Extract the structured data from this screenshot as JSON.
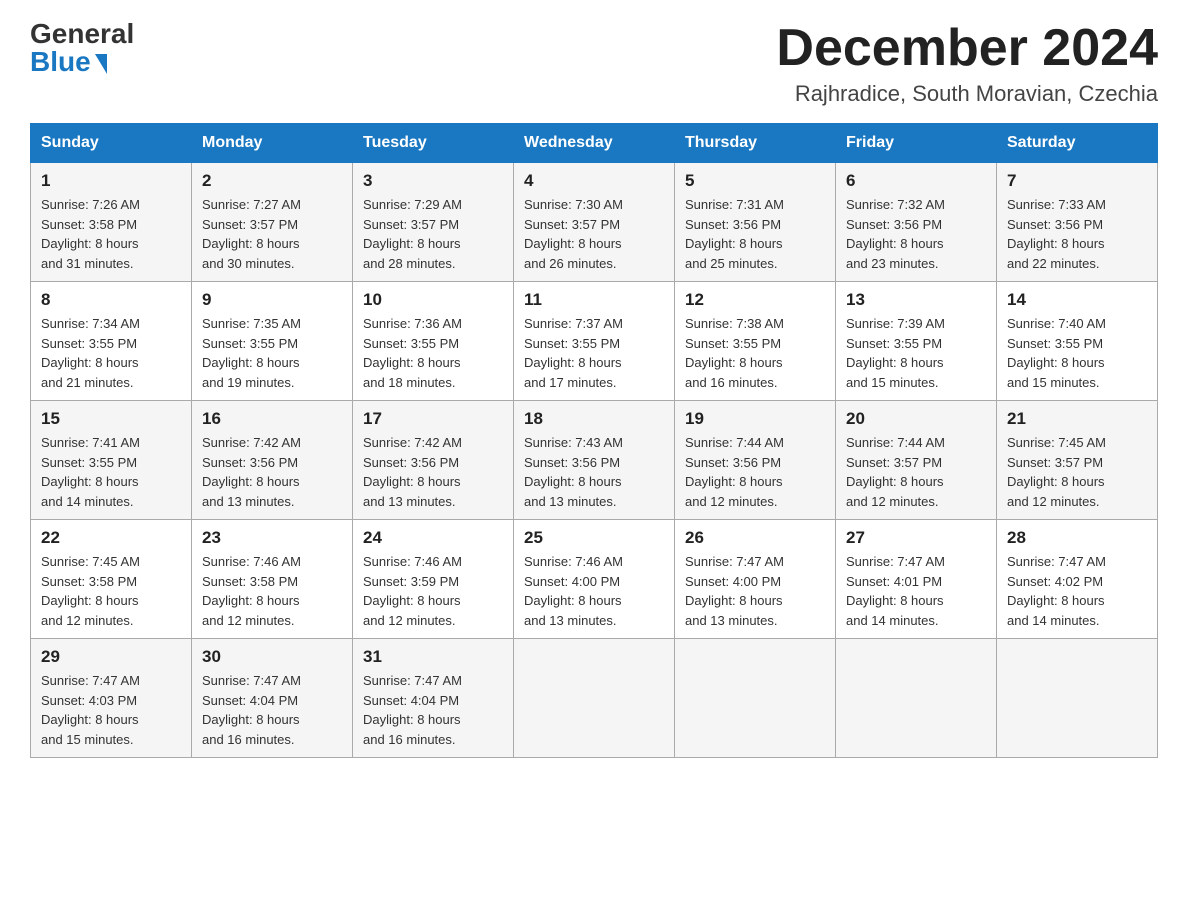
{
  "logo": {
    "general": "General",
    "blue": "Blue"
  },
  "title": "December 2024",
  "location": "Rajhradice, South Moravian, Czechia",
  "days_of_week": [
    "Sunday",
    "Monday",
    "Tuesday",
    "Wednesday",
    "Thursday",
    "Friday",
    "Saturday"
  ],
  "weeks": [
    [
      {
        "day": "1",
        "sunrise": "7:26 AM",
        "sunset": "3:58 PM",
        "daylight": "8 hours and 31 minutes."
      },
      {
        "day": "2",
        "sunrise": "7:27 AM",
        "sunset": "3:57 PM",
        "daylight": "8 hours and 30 minutes."
      },
      {
        "day": "3",
        "sunrise": "7:29 AM",
        "sunset": "3:57 PM",
        "daylight": "8 hours and 28 minutes."
      },
      {
        "day": "4",
        "sunrise": "7:30 AM",
        "sunset": "3:57 PM",
        "daylight": "8 hours and 26 minutes."
      },
      {
        "day": "5",
        "sunrise": "7:31 AM",
        "sunset": "3:56 PM",
        "daylight": "8 hours and 25 minutes."
      },
      {
        "day": "6",
        "sunrise": "7:32 AM",
        "sunset": "3:56 PM",
        "daylight": "8 hours and 23 minutes."
      },
      {
        "day": "7",
        "sunrise": "7:33 AM",
        "sunset": "3:56 PM",
        "daylight": "8 hours and 22 minutes."
      }
    ],
    [
      {
        "day": "8",
        "sunrise": "7:34 AM",
        "sunset": "3:55 PM",
        "daylight": "8 hours and 21 minutes."
      },
      {
        "day": "9",
        "sunrise": "7:35 AM",
        "sunset": "3:55 PM",
        "daylight": "8 hours and 19 minutes."
      },
      {
        "day": "10",
        "sunrise": "7:36 AM",
        "sunset": "3:55 PM",
        "daylight": "8 hours and 18 minutes."
      },
      {
        "day": "11",
        "sunrise": "7:37 AM",
        "sunset": "3:55 PM",
        "daylight": "8 hours and 17 minutes."
      },
      {
        "day": "12",
        "sunrise": "7:38 AM",
        "sunset": "3:55 PM",
        "daylight": "8 hours and 16 minutes."
      },
      {
        "day": "13",
        "sunrise": "7:39 AM",
        "sunset": "3:55 PM",
        "daylight": "8 hours and 15 minutes."
      },
      {
        "day": "14",
        "sunrise": "7:40 AM",
        "sunset": "3:55 PM",
        "daylight": "8 hours and 15 minutes."
      }
    ],
    [
      {
        "day": "15",
        "sunrise": "7:41 AM",
        "sunset": "3:55 PM",
        "daylight": "8 hours and 14 minutes."
      },
      {
        "day": "16",
        "sunrise": "7:42 AM",
        "sunset": "3:56 PM",
        "daylight": "8 hours and 13 minutes."
      },
      {
        "day": "17",
        "sunrise": "7:42 AM",
        "sunset": "3:56 PM",
        "daylight": "8 hours and 13 minutes."
      },
      {
        "day": "18",
        "sunrise": "7:43 AM",
        "sunset": "3:56 PM",
        "daylight": "8 hours and 13 minutes."
      },
      {
        "day": "19",
        "sunrise": "7:44 AM",
        "sunset": "3:56 PM",
        "daylight": "8 hours and 12 minutes."
      },
      {
        "day": "20",
        "sunrise": "7:44 AM",
        "sunset": "3:57 PM",
        "daylight": "8 hours and 12 minutes."
      },
      {
        "day": "21",
        "sunrise": "7:45 AM",
        "sunset": "3:57 PM",
        "daylight": "8 hours and 12 minutes."
      }
    ],
    [
      {
        "day": "22",
        "sunrise": "7:45 AM",
        "sunset": "3:58 PM",
        "daylight": "8 hours and 12 minutes."
      },
      {
        "day": "23",
        "sunrise": "7:46 AM",
        "sunset": "3:58 PM",
        "daylight": "8 hours and 12 minutes."
      },
      {
        "day": "24",
        "sunrise": "7:46 AM",
        "sunset": "3:59 PM",
        "daylight": "8 hours and 12 minutes."
      },
      {
        "day": "25",
        "sunrise": "7:46 AM",
        "sunset": "4:00 PM",
        "daylight": "8 hours and 13 minutes."
      },
      {
        "day": "26",
        "sunrise": "7:47 AM",
        "sunset": "4:00 PM",
        "daylight": "8 hours and 13 minutes."
      },
      {
        "day": "27",
        "sunrise": "7:47 AM",
        "sunset": "4:01 PM",
        "daylight": "8 hours and 14 minutes."
      },
      {
        "day": "28",
        "sunrise": "7:47 AM",
        "sunset": "4:02 PM",
        "daylight": "8 hours and 14 minutes."
      }
    ],
    [
      {
        "day": "29",
        "sunrise": "7:47 AM",
        "sunset": "4:03 PM",
        "daylight": "8 hours and 15 minutes."
      },
      {
        "day": "30",
        "sunrise": "7:47 AM",
        "sunset": "4:04 PM",
        "daylight": "8 hours and 16 minutes."
      },
      {
        "day": "31",
        "sunrise": "7:47 AM",
        "sunset": "4:04 PM",
        "daylight": "8 hours and 16 minutes."
      },
      null,
      null,
      null,
      null
    ]
  ],
  "labels": {
    "sunrise": "Sunrise:",
    "sunset": "Sunset:",
    "daylight": "Daylight:"
  }
}
